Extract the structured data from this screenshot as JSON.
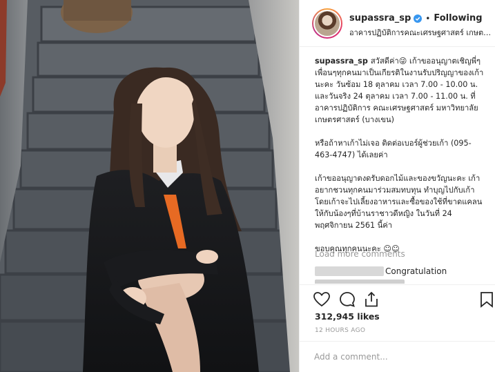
{
  "header": {
    "username": "supassra_sp",
    "separator": "•",
    "follow_state": "Following",
    "location": "อาคารปฏิบัติการคณะเศรษฐศาสตร์ เกษตรศาสตร์"
  },
  "caption": {
    "username": "supassra_sp",
    "p1": "สวัสดีค่า😜 เก้าขออนุญาตเชิญพี่ๆเพื่อนๆทุกคนมาเป็นเกียรติในงานรับปริญญาของเก้านะคะ วันซ้อม 18 ตุลาคม เวลา 7.00 - 10.00 น. และวันจริง 24 ตุลาคม เวลา 7.00 - 11.00 น. ที่อาคารปฏิบัติการ คณะเศรษฐศาสตร์ มหาวิทยาลัยเกษตรศาสตร์ (บางเขน)",
    "p2": "หรือถ้าหาเก้าไม่เจอ ติดต่อเบอร์ผู้ช่วยเก้า (095-463-4747) ได้เลยค่า",
    "p3": "เก้าขออนุญาตงดรับดอกไม้และของขวัญนะคะ เก้าอยากชวนทุกคนมาร่วมสมทบทุน ทำบุญไปกับเก้า โดยเก้าจะไปเลี้ยงอาหารและซื้อของใช้ที่ขาดแคลนให้กับน้องๆที่บ้านราชาวดีหญิง ในวันที่ 24 พฤศจิกายน 2561 นี้ค่า",
    "p4": "ขอบคุณทุกคนนะคะ ☺☺"
  },
  "comments": {
    "load_more": "Load more comments",
    "first_text": "Congratulation"
  },
  "actions": {
    "like_icon": "heart-icon",
    "comment_icon": "comment-icon",
    "share_icon": "share-icon",
    "save_icon": "bookmark-icon"
  },
  "likes": "312,945 likes",
  "timestamp": "12 HOURS AGO",
  "add_comment": {
    "placeholder": "Add a comment..."
  },
  "colors": {
    "verified": "#3897f0",
    "muted": "#999999",
    "text": "#262626",
    "border": "#efefef"
  }
}
